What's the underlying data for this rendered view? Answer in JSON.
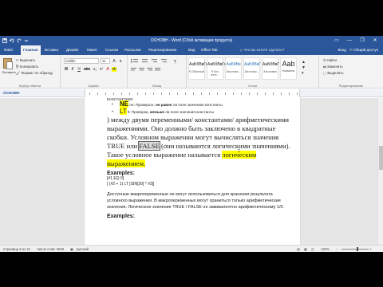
{
  "window": {
    "title": "ОСНОВН - Word (Сбой активации продукта)",
    "minimize": "—",
    "maximize": "❐",
    "close": "✕"
  },
  "tabs": [
    "Файл",
    "Главная",
    "Вставка",
    "Дизайн",
    "Макет",
    "Ссылки",
    "Рассылки",
    "Рецензирование",
    "Вид",
    "Office Tab"
  ],
  "tell_me": "Что вы хотите сделать?",
  "account": "Вход",
  "share": "Общий доступ",
  "ribbon": {
    "clipboard": {
      "paste": "Вставить",
      "cut": "Вырезать",
      "copy": "Копировать",
      "format_painter": "Формат по образцу",
      "label": "Буфер обмена"
    },
    "font": {
      "family": "Calibri",
      "size": "11",
      "label": "Шрифт",
      "buttons": [
        "Ж",
        "К",
        "Ч",
        "abc",
        "x₂",
        "x²"
      ]
    },
    "paragraph": {
      "label": "Абзац"
    },
    "styles": {
      "label": "Стили",
      "items": [
        {
          "sample": "АаБбВвГг",
          "name": "¶ Обычный"
        },
        {
          "sample": "АаБбВвГг",
          "name": "¶ Без инте..."
        },
        {
          "sample": "АаБбВв",
          "name": "Заголово..."
        },
        {
          "sample": "АаБбВвГ",
          "name": "Заголово..."
        },
        {
          "sample": "АаБбВвГ",
          "name": "Заголовок"
        },
        {
          "sample": "Aab",
          "name": "Название"
        }
      ]
    },
    "editing": {
      "find": "Найти",
      "replace": "Заменить",
      "select": "Выделить",
      "label": "Редактирование"
    }
  },
  "nav": {
    "title": "ОСНОВН"
  },
  "document": {
    "bullets": [
      {
        "code": "NE",
        "text_a": " ne: Проверьте, ",
        "bold": "не равно",
        "text_b": " ли поле значению константы"
      },
      {
        "code": "LT",
        "text_a": " lt: Проверка, ",
        "bold": "меньше",
        "text_b": " ли поле значения константы"
      }
    ],
    "para1_a": ") между двумя переменными/ константами/ арифметическими выражениями. Оно должно быть заключено в квадратные скобки. Условном выражении могут вычисляться значения TRUE или ",
    "para1_false": "FALSE",
    "para1_b": " (они называются логическими значениями). Такое условное выражение называется ",
    "para1_hl": "логическим выражением.",
    "examples_1": "Examples:",
    "code_1": "[#1 EQ 0]",
    "code_2": "[ (#2 + 1) LT [SIN[30] * #3]]",
    "para2": "Доступные макропеременные не могут использоваться для хранения результата условного выражения. В макропеременных могут храниться только арифметические значения. Логическое значение TRUE / FALSE не эквивалентно арифметическому 1/0.",
    "examples_2": "Examples:"
  },
  "status": {
    "page": "Страница 3 из 13",
    "words": "Число слов: 2629",
    "lang": "русский",
    "zoom": "120%",
    "zoom_level": 0.6
  }
}
